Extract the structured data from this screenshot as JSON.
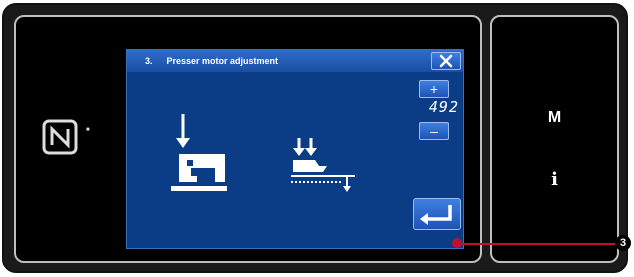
{
  "dialog": {
    "step": "3.",
    "title": "Presser motor adjustment",
    "plus_label": "+",
    "value": "492",
    "minus_label": "–"
  },
  "side_keys": {
    "mode": "M",
    "info": "i"
  },
  "callout": {
    "marker": "3"
  },
  "icons": [
    "nfc-icon",
    "close-icon",
    "sewing-machine-icon",
    "presser-foot-icon",
    "enter-icon"
  ],
  "colors": {
    "panel_bg": "#000000",
    "dialog_bg": "#0a3d86",
    "button": "#1d54b5",
    "callout": "#c0102c"
  }
}
